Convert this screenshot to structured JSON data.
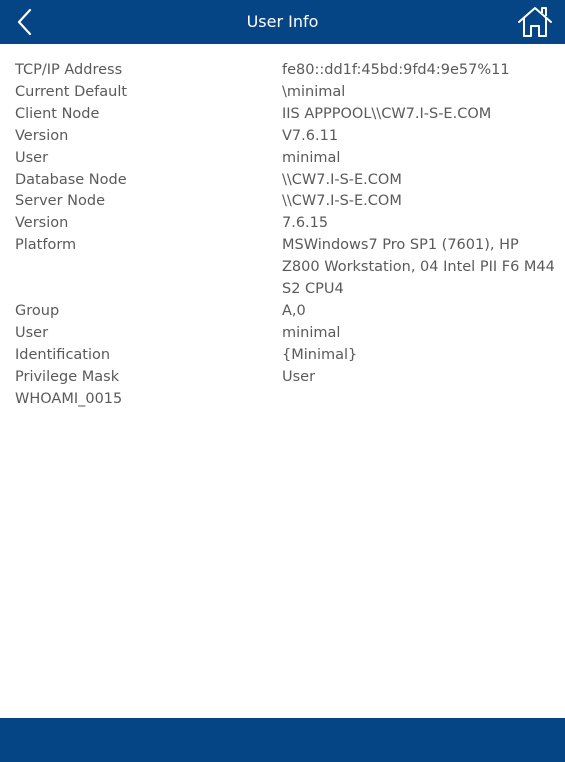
{
  "header": {
    "title": "User Info",
    "back_icon": "chevron-left-icon",
    "home_icon": "home-icon"
  },
  "colors": {
    "bar": "#064585",
    "text": "#5a5a5a"
  },
  "rows": [
    {
      "label": "TCP/IP Address",
      "value": "fe80::dd1f:45bd:9fd4:9e57%11"
    },
    {
      "label": "Current Default",
      "value": "\\minimal"
    },
    {
      "label": "Client Node",
      "value": "IIS APPPOOL\\\\CW7.I-S-E.COM"
    },
    {
      "label": "Version",
      "value": "V7.6.11"
    },
    {
      "label": "User",
      "value": "minimal"
    },
    {
      "label": "Database Node",
      "value": "\\\\CW7.I-S-E.COM"
    },
    {
      "label": "Server Node",
      "value": "\\\\CW7.I-S-E.COM"
    },
    {
      "label": "Version",
      "value": "7.6.15"
    },
    {
      "label": "Platform",
      "value": "MSWindows7 Pro SP1 (7601), HP\nZ800 Workstation, 04 Intel PII F6 M44\nS2 CPU4"
    },
    {
      "label": "Group",
      "value": "A,0"
    },
    {
      "label": "User",
      "value": "minimal"
    },
    {
      "label": "Identification",
      "value": "{Minimal}"
    },
    {
      "label": "Privilege Mask",
      "value": "User"
    },
    {
      "label": "WHOAMI_0015",
      "value": ""
    }
  ]
}
